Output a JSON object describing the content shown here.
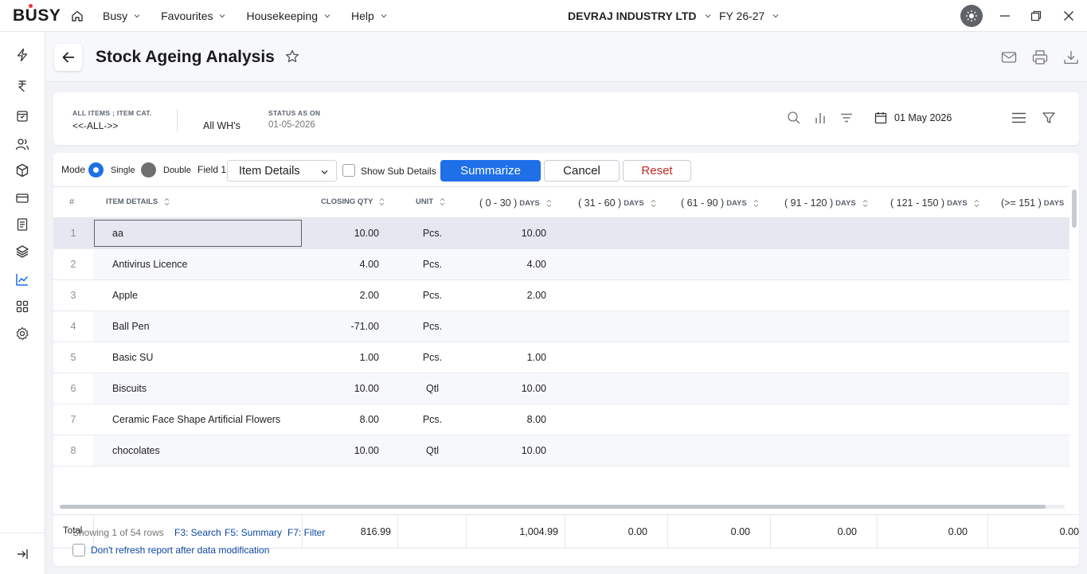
{
  "app": {
    "logo": "BUSY",
    "menu": [
      "Busy",
      "Favourites",
      "Housekeeping",
      "Help"
    ],
    "company": "DEVRAJ INDUSTRY LTD",
    "fy": "FY 26-27"
  },
  "page": {
    "title": "Stock Ageing Analysis"
  },
  "filters": {
    "items_label": "ALL ITEMS ; ITEM CAT.",
    "items_value": "<<-ALL->>",
    "warehouse_value": "All WH's",
    "status_label": "STATUS AS ON",
    "status_value": "01-05-2026",
    "date": "01 May 2026"
  },
  "options": {
    "mode_label": "Mode",
    "single_label": "Single",
    "double_label": "Double",
    "field_label": "Field 1",
    "field_value": "Item Details",
    "show_sub_label": "Show Sub Details",
    "summarize_label": "Summarize",
    "cancel_label": "Cancel",
    "reset_label": "Reset"
  },
  "table": {
    "headers": {
      "num": "#",
      "item": "ITEM DETAILS",
      "qty": "CLOSING QTY",
      "unit": "UNIT",
      "b1": "( 0 - 30 )",
      "b2": "( 31 - 60 )",
      "b3": "( 61 - 90 )",
      "b4": "( 91 - 120 )",
      "b5": "( 121 - 150 )",
      "b6": "(>= 151 )",
      "days": "DAYS"
    },
    "rows": [
      {
        "n": "1",
        "item": "aa",
        "qty": "10.00",
        "unit": "Pcs.",
        "b1": "10.00"
      },
      {
        "n": "2",
        "item": "Antivirus Licence",
        "qty": "4.00",
        "unit": "Pcs.",
        "b1": "4.00"
      },
      {
        "n": "3",
        "item": "Apple",
        "qty": "2.00",
        "unit": "Pcs.",
        "b1": "2.00"
      },
      {
        "n": "4",
        "item": "Ball Pen",
        "qty": "-71.00",
        "unit": "Pcs.",
        "b1": ""
      },
      {
        "n": "5",
        "item": "Basic SU",
        "qty": "1.00",
        "unit": "Pcs.",
        "b1": "1.00"
      },
      {
        "n": "6",
        "item": "Biscuits",
        "qty": "10.00",
        "unit": "Qtl",
        "b1": "10.00"
      },
      {
        "n": "7",
        "item": "Ceramic Face Shape Artificial Flowers",
        "qty": "8.00",
        "unit": "Pcs.",
        "b1": "8.00"
      },
      {
        "n": "8",
        "item": "chocolates",
        "qty": "10.00",
        "unit": "Qtl",
        "b1": "10.00"
      }
    ],
    "total": {
      "label": "Total",
      "qty": "816.99",
      "b1": "1,004.99",
      "b2": "0.00",
      "b3": "0.00",
      "b4": "0.00",
      "b5": "0.00",
      "b6": "0.00"
    }
  },
  "footer": {
    "showing": "Showing 1 of 54 rows",
    "f3": "F3: Search",
    "f5": "F5: Summary",
    "f7": "F7: Filter",
    "refresh_label": "Don't refresh report after data modification"
  },
  "colors": {
    "accent": "#1e6fe8",
    "reset": "#c62828",
    "link": "#0d47a1"
  }
}
